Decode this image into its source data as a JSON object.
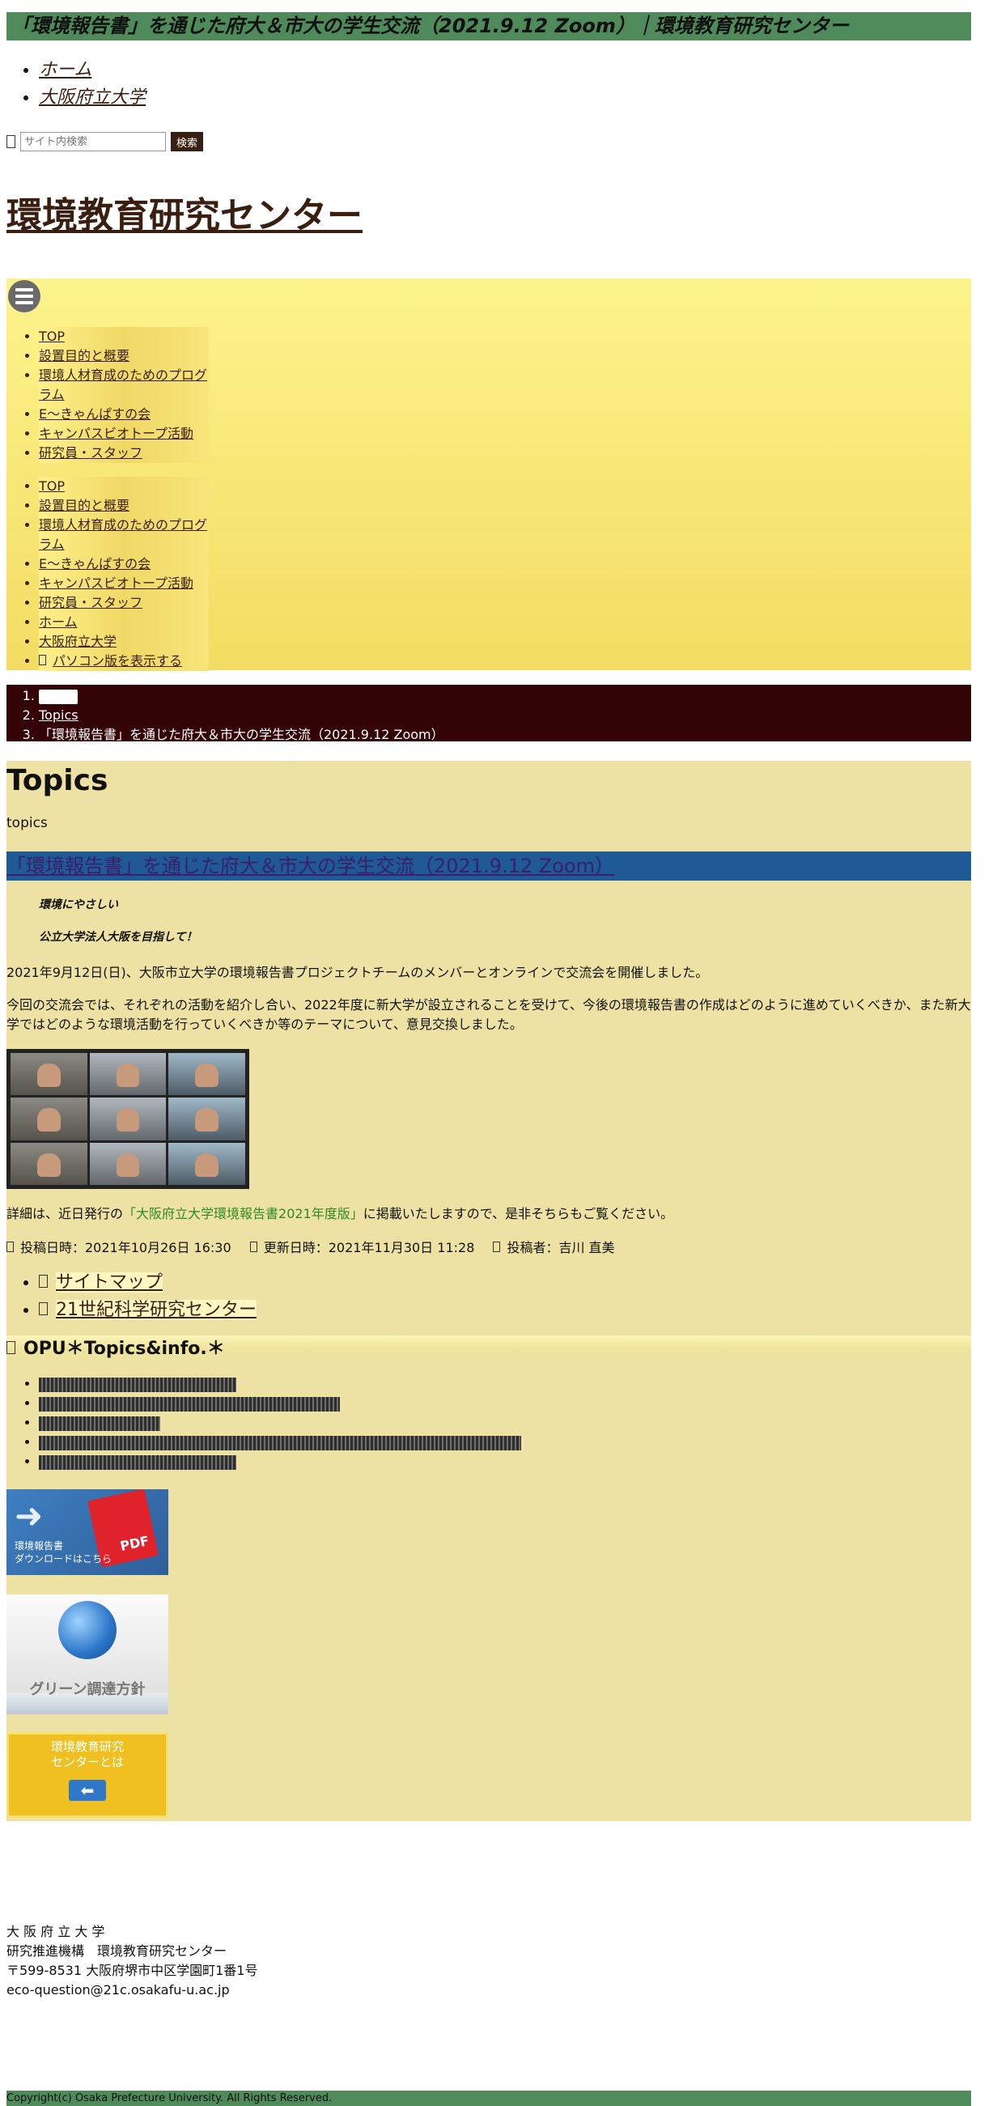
{
  "window_title": "「環境報告書」を通じた府大＆市大の学生交流（2021.9.12 Zoom）｜環境教育研究センター",
  "top_nav": [
    {
      "label": "ホーム"
    },
    {
      "label": "大阪府立大学"
    }
  ],
  "search": {
    "placeholder": "サイト内検索",
    "button_label": "検索"
  },
  "site_title": "環境教育研究センター",
  "nav_menu_primary": [
    {
      "label": "TOP"
    },
    {
      "label": "設置目的と概要"
    },
    {
      "label": "環境人材育成のためのプログラム"
    },
    {
      "label": "E～きゃんぱすの会"
    },
    {
      "label": "キャンパスビオトープ活動"
    },
    {
      "label": "研究員・スタッフ"
    }
  ],
  "nav_menu_secondary": [
    {
      "label": "TOP"
    },
    {
      "label": "設置目的と概要"
    },
    {
      "label": "環境人材育成のためのプログラム"
    },
    {
      "label": "E～きゃんぱすの会"
    },
    {
      "label": "キャンパスビオトープ活動"
    },
    {
      "label": "研究員・スタッフ"
    },
    {
      "label": "ホーム"
    },
    {
      "label": "大阪府立大学"
    },
    {
      "label": "パソコン版を表示する"
    }
  ],
  "breadcrumb": {
    "item2": "Topics",
    "item3": "「環境報告書」を通じた府大＆市大の学生交流（2021.9.12 Zoom）"
  },
  "main": {
    "heading": "Topics",
    "subheading": "topics",
    "post_title": "「環境報告書」を通じた府大＆市大の学生交流（2021.9.12 Zoom）",
    "emphasis1": "環境にやさしい",
    "emphasis2": "公立大学法人大阪を目指して！",
    "paragraph1": "2021年9月12日(日)、大阪市立大学の環境報告書プロジェクトチームのメンバーとオンラインで交流会を開催しました。",
    "paragraph2": "今回の交流会では、それぞれの活動を紹介し合い、2022年度に新大学が設立されることを受けて、今後の環境報告書の作成はどのように進めていくべきか、また新大学ではどのような環境活動を行っていくべきか等のテーマについて、意見交換しました。",
    "paragraph3_before": "詳細は、近日発行の",
    "paragraph3_link": "「大阪府立大学環境報告書2021年度版」",
    "paragraph3_after": "に掲載いたしますので、是非そちらもご覧ください。",
    "posted": "投稿日時：2021年10月26日 16:30",
    "updated": "更新日時：2021年11月30日 11:28",
    "author": "投稿者：吉川 直美"
  },
  "bottom_links": [
    {
      "label": "サイトマップ"
    },
    {
      "label": "21世紀科学研究センター"
    }
  ],
  "opu_section": {
    "heading": "OPU＊Topics&info.＊"
  },
  "banners": {
    "pdf_banner_text_line1": "環境報告書",
    "pdf_banner_text_line2": "ダウンロードはこちら",
    "pdf_badge": "PDF",
    "green_banner_text": "グリーン調達方針",
    "center_banner_line1": "環境教育研究",
    "center_banner_line2": "センターとは"
  },
  "footer": {
    "line1": "大 阪 府 立 大 学",
    "line2": "研究推進機構　環境教育研究センター",
    "line3": "〒599-8531 大阪府堺市中区学園町1番1号",
    "line4": "eco-question@21c.osakafu-u.ac.jp",
    "copyright": "Copyright(c) Osaka Prefecture University. All Rights Reserved."
  },
  "colors": {
    "titlebar_bg": "#4e8a5a",
    "breadcrumb_bg": "#340305",
    "content_bg": "#ede2a3",
    "post_title_bg": "#1f5996",
    "nav_gradient_top": "#fdf38c"
  }
}
